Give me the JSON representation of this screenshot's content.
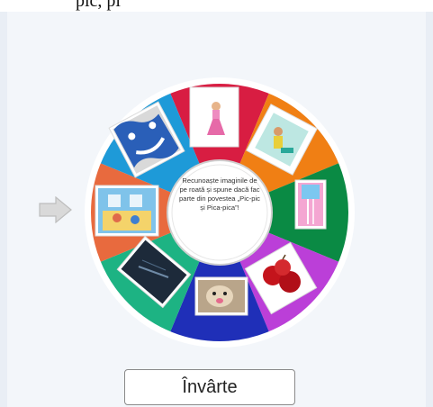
{
  "page": {
    "top_text": "pic, pi",
    "hub_text": "Recunoaște imaginile de pe roată și spune dacă fac parte din povestea „Pic-pic și Pica-pica”!",
    "spin_label": "Învârte"
  },
  "wheel": {
    "segments": [
      {
        "color": "#d81d42",
        "image": "girl-pink-dress-picture"
      },
      {
        "color": "#f07f14",
        "image": "girl-playing-picture"
      },
      {
        "color": "#0a8a44",
        "image": "pink-waterfall-picture"
      },
      {
        "color": "#bb3fd8",
        "image": "red-apples-picture"
      },
      {
        "color": "#1f2fb8",
        "image": "puppy-picture"
      },
      {
        "color": "#1db383",
        "image": "rainy-window-picture"
      },
      {
        "color": "#e86a3e",
        "image": "blue-room-picture"
      },
      {
        "color": "#1e9ad8",
        "image": "smiley-faces-picture"
      }
    ]
  }
}
